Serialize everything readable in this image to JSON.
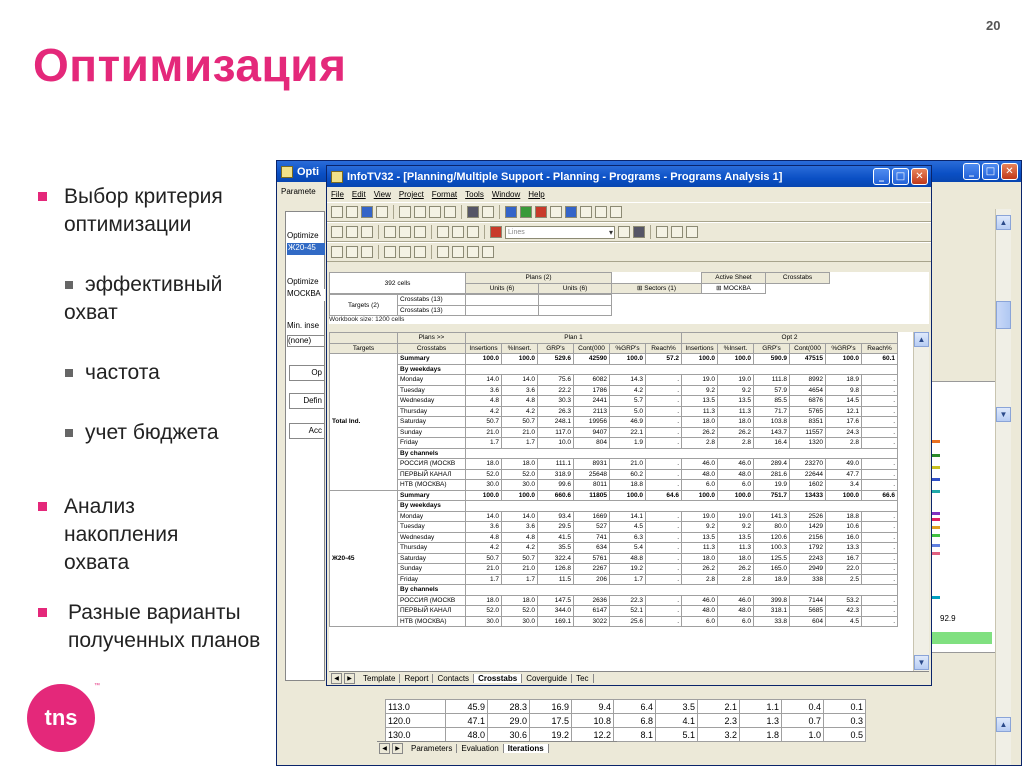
{
  "slide": {
    "number": "20",
    "title": "Оптимизация",
    "bullets": [
      {
        "text_l1": "Выбор критерия",
        "text_l2": "оптимизации"
      },
      {
        "text_l1": "Анализ",
        "text_l2": "накопления",
        "text_l3": "охвата"
      },
      {
        "text_l1": "Разные варианты",
        "text_l2": "полученных планов"
      }
    ],
    "sub_bullets": [
      {
        "l1": "эффективный",
        "l2": "охват"
      },
      {
        "l1": "частота"
      },
      {
        "l1": "учет бюджета"
      }
    ],
    "logo": "tns",
    "logo_tm": "™"
  },
  "back_window": {
    "title": "Opti",
    "left_panel": {
      "param_label": "Paramete",
      "optimize1": "Optimize",
      "sel1": "Ж20-45",
      "optimize2": "Optimize",
      "sel2": "МОСКВА",
      "min_ins": "Min. inse",
      "none": "(none)",
      "btn_op": "Op",
      "btn_defin": "Defin",
      "btn_acc": "Acc"
    },
    "bottom_table": {
      "rows": [
        [
          "113.0",
          "45.9",
          "28.3",
          "16.9",
          "9.4",
          "6.4",
          "3.5",
          "2.1",
          "1.1",
          "0.4",
          "0.1"
        ],
        [
          "120.0",
          "47.1",
          "29.0",
          "17.5",
          "10.8",
          "6.8",
          "4.1",
          "2.3",
          "1.3",
          "0.7",
          "0.3"
        ],
        [
          "130.0",
          "48.0",
          "30.6",
          "19.2",
          "12.2",
          "8.1",
          "5.1",
          "3.2",
          "1.8",
          "1.0",
          "0.5"
        ]
      ],
      "right_value": "92.9",
      "tabs": [
        "Parameters",
        "Evaluation",
        "Iterations"
      ],
      "active_tab": "Iterations"
    }
  },
  "main_window": {
    "title": "InfoTV32 - [Planning/Multiple Support - Planning - Programs - Programs Analysis 1]",
    "menu": [
      "File",
      "Edit",
      "View",
      "Project",
      "Format",
      "Tools",
      "Window",
      "Help"
    ],
    "combo_placeholder": "Lines",
    "top_info": {
      "cells": "392 cells",
      "plans": "Plans (2)",
      "units1": "Units (6)",
      "units2": "Units (6)",
      "sectors": "Sectors (1)",
      "active_sheet": "Active Sheet",
      "crosstabs": "Crosstabs",
      "moskva": "МОСКВА",
      "targets": "Targets (2)",
      "crosstabs13a": "Crosstabs (13)",
      "crosstabs13b": "Crosstabs (13)",
      "workbook": "Workbook size: 1200 cells"
    },
    "grid": {
      "plans_label": "Plans >>",
      "plan1": "Plan 1",
      "opt2": "Opt 2",
      "targets_h": "Targets",
      "crosstabs_h": "Crosstabs",
      "cols": [
        "Insertions",
        "%Insert.",
        "GRP's",
        "Cont(000",
        "%GRP's",
        "Reach%"
      ],
      "groups": [
        {
          "target": "Total Ind.",
          "rows": [
            {
              "label": "Summary",
              "type": "sum",
              "p1": [
                "100.0",
                "100.0",
                "529.6",
                "42590",
                "100.0",
                "57.2"
              ],
              "p2": [
                "100.0",
                "100.0",
                "590.9",
                "47515",
                "100.0",
                "60.1"
              ]
            },
            {
              "label": "By weekdays",
              "type": "section"
            },
            {
              "label": "Monday",
              "p1": [
                "14.0",
                "14.0",
                "75.6",
                "6082",
                "14.3",
                "."
              ],
              "p2": [
                "19.0",
                "19.0",
                "111.8",
                "8992",
                "18.9",
                "."
              ]
            },
            {
              "label": "Tuesday",
              "p1": [
                "3.6",
                "3.6",
                "22.2",
                "1786",
                "4.2",
                "."
              ],
              "p2": [
                "9.2",
                "9.2",
                "57.9",
                "4654",
                "9.8",
                "."
              ]
            },
            {
              "label": "Wednesday",
              "p1": [
                "4.8",
                "4.8",
                "30.3",
                "2441",
                "5.7",
                "."
              ],
              "p2": [
                "13.5",
                "13.5",
                "85.5",
                "6876",
                "14.5",
                "."
              ]
            },
            {
              "label": "Thursday",
              "p1": [
                "4.2",
                "4.2",
                "26.3",
                "2113",
                "5.0",
                "."
              ],
              "p2": [
                "11.3",
                "11.3",
                "71.7",
                "5765",
                "12.1",
                "."
              ]
            },
            {
              "label": "Saturday",
              "p1": [
                "50.7",
                "50.7",
                "248.1",
                "19956",
                "46.9",
                "."
              ],
              "p2": [
                "18.0",
                "18.0",
                "103.8",
                "8351",
                "17.6",
                "."
              ]
            },
            {
              "label": "Sunday",
              "p1": [
                "21.0",
                "21.0",
                "117.0",
                "9407",
                "22.1",
                "."
              ],
              "p2": [
                "26.2",
                "26.2",
                "143.7",
                "11557",
                "24.3",
                "."
              ]
            },
            {
              "label": "Friday",
              "p1": [
                "1.7",
                "1.7",
                "10.0",
                "804",
                "1.9",
                "."
              ],
              "p2": [
                "2.8",
                "2.8",
                "16.4",
                "1320",
                "2.8",
                "."
              ]
            },
            {
              "label": "By channels",
              "type": "section"
            },
            {
              "label": "РОССИЯ (МОСКВ",
              "p1": [
                "18.0",
                "18.0",
                "111.1",
                "8931",
                "21.0",
                "."
              ],
              "p2": [
                "46.0",
                "46.0",
                "289.4",
                "23270",
                "49.0",
                "."
              ]
            },
            {
              "label": "ПЕРВЫЙ КАНАЛ",
              "p1": [
                "52.0",
                "52.0",
                "318.9",
                "25648",
                "60.2",
                "."
              ],
              "p2": [
                "48.0",
                "48.0",
                "281.6",
                "22644",
                "47.7",
                "."
              ]
            },
            {
              "label": "НТВ (МОСКВА)",
              "p1": [
                "30.0",
                "30.0",
                "99.6",
                "8011",
                "18.8",
                "."
              ],
              "p2": [
                "6.0",
                "6.0",
                "19.9",
                "1602",
                "3.4",
                "."
              ]
            }
          ]
        },
        {
          "target": "Ж20-45",
          "rows": [
            {
              "label": "Summary",
              "type": "sum",
              "p1": [
                "100.0",
                "100.0",
                "660.6",
                "11805",
                "100.0",
                "64.6"
              ],
              "p2": [
                "100.0",
                "100.0",
                "751.7",
                "13433",
                "100.0",
                "66.6"
              ]
            },
            {
              "label": "By weekdays",
              "type": "section"
            },
            {
              "label": "Monday",
              "p1": [
                "14.0",
                "14.0",
                "93.4",
                "1669",
                "14.1",
                "."
              ],
              "p2": [
                "19.0",
                "19.0",
                "141.3",
                "2526",
                "18.8",
                "."
              ]
            },
            {
              "label": "Tuesday",
              "p1": [
                "3.6",
                "3.6",
                "29.5",
                "527",
                "4.5",
                "."
              ],
              "p2": [
                "9.2",
                "9.2",
                "80.0",
                "1429",
                "10.6",
                "."
              ]
            },
            {
              "label": "Wednesday",
              "p1": [
                "4.8",
                "4.8",
                "41.5",
                "741",
                "6.3",
                "."
              ],
              "p2": [
                "13.5",
                "13.5",
                "120.6",
                "2156",
                "16.0",
                "."
              ]
            },
            {
              "label": "Thursday",
              "p1": [
                "4.2",
                "4.2",
                "35.5",
                "634",
                "5.4",
                "."
              ],
              "p2": [
                "11.3",
                "11.3",
                "100.3",
                "1792",
                "13.3",
                "."
              ]
            },
            {
              "label": "Saturday",
              "p1": [
                "50.7",
                "50.7",
                "322.4",
                "5761",
                "48.8",
                "."
              ],
              "p2": [
                "18.0",
                "18.0",
                "125.5",
                "2243",
                "16.7",
                "."
              ]
            },
            {
              "label": "Sunday",
              "p1": [
                "21.0",
                "21.0",
                "126.8",
                "2267",
                "19.2",
                "."
              ],
              "p2": [
                "26.2",
                "26.2",
                "165.0",
                "2949",
                "22.0",
                "."
              ]
            },
            {
              "label": "Friday",
              "p1": [
                "1.7",
                "1.7",
                "11.5",
                "206",
                "1.7",
                "."
              ],
              "p2": [
                "2.8",
                "2.8",
                "18.9",
                "338",
                "2.5",
                "."
              ]
            },
            {
              "label": "By channels",
              "type": "section"
            },
            {
              "label": "РОССИЯ (МОСКВ",
              "p1": [
                "18.0",
                "18.0",
                "147.5",
                "2636",
                "22.3",
                "."
              ],
              "p2": [
                "46.0",
                "46.0",
                "399.8",
                "7144",
                "53.2",
                "."
              ]
            },
            {
              "label": "ПЕРВЫЙ КАНАЛ",
              "p1": [
                "52.0",
                "52.0",
                "344.0",
                "6147",
                "52.1",
                "."
              ],
              "p2": [
                "48.0",
                "48.0",
                "318.1",
                "5685",
                "42.3",
                "."
              ]
            },
            {
              "label": "НТВ (МОСКВА)",
              "p1": [
                "30.0",
                "30.0",
                "169.1",
                "3022",
                "25.6",
                "."
              ],
              "p2": [
                "6.0",
                "6.0",
                "33.8",
                "604",
                "4.5",
                "."
              ]
            }
          ]
        }
      ]
    },
    "tabs": [
      "Template",
      "Report",
      "Contacts",
      "Crosstabs",
      "Coverguide",
      "Tec"
    ],
    "active_tab": "Crosstabs"
  }
}
